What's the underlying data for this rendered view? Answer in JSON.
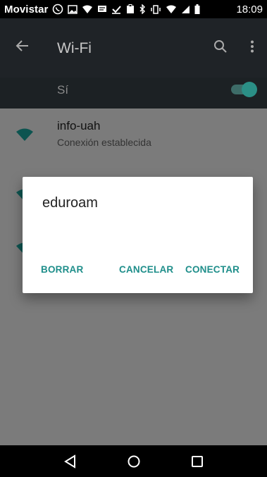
{
  "status_bar": {
    "carrier": "Movistar",
    "time": "18:09"
  },
  "app_bar": {
    "title": "Wi-Fi"
  },
  "wifi_switch": {
    "label": "Sí"
  },
  "networks": [
    {
      "name": "info-uah",
      "status": "Conexión establecida"
    }
  ],
  "dialog": {
    "title": "eduroam",
    "buttons": {
      "forget": "BORRAR",
      "cancel": "CANCELAR",
      "connect": "CONECTAR"
    }
  },
  "colors": {
    "accent": "#1e8e8a",
    "app_bar": "#1f2327",
    "toggle_on": "#2b8f86",
    "wifi_icon": "#0d5450"
  }
}
